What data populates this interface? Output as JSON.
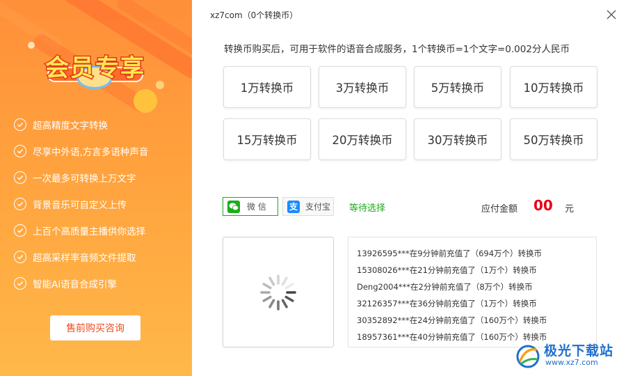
{
  "left_panel": {
    "badge_title": "会员专享",
    "features": [
      "超高精度文字转换",
      "尽享中外语,方言多语种声音",
      "一次最多可转换上万文字",
      "背景音乐可自定义上传",
      "上百个高质量主播供你选择",
      "超高采样率音频文件提取",
      "智能Ai语音合成引擎"
    ],
    "consult_button": "售前购买咨询"
  },
  "header": {
    "title": "xz7com（0个转换币）",
    "close_icon": "close-icon"
  },
  "description": "转换币购买后，可用于软件的语音合成服务，1个转换币=1个文字=0.002分人民币",
  "packages": [
    "1万转换币",
    "3万转换币",
    "5万转换币",
    "10万转换币",
    "15万转换币",
    "20万转换币",
    "30万转换币",
    "50万转换币"
  ],
  "payment": {
    "wechat_label": "微 信",
    "alipay_label": "支付宝",
    "alipay_glyph": "支",
    "status": "等待选择",
    "amount_label": "应付金额",
    "amount_value": "00",
    "amount_unit": "元"
  },
  "records": [
    "13926595***在9分钟前充值了（694万个）转换币",
    "15308026***在21分钟前充值了（1万个）转换币",
    "Deng2004***在2分钟前充值了（8万个）转换币",
    "32126357***在36分钟前充值了（1万个）转换币",
    "30352892***在24分钟前充值了（160万个）转换币",
    "18957361***在40分钟前充值了（160万个）转换币"
  ],
  "watermark": {
    "name": "极光下载站",
    "url": "www.xz7.com"
  },
  "colors": {
    "accent_orange": "#ff8f3a",
    "wechat_green": "#1aad19",
    "amount_red": "#e60012"
  }
}
